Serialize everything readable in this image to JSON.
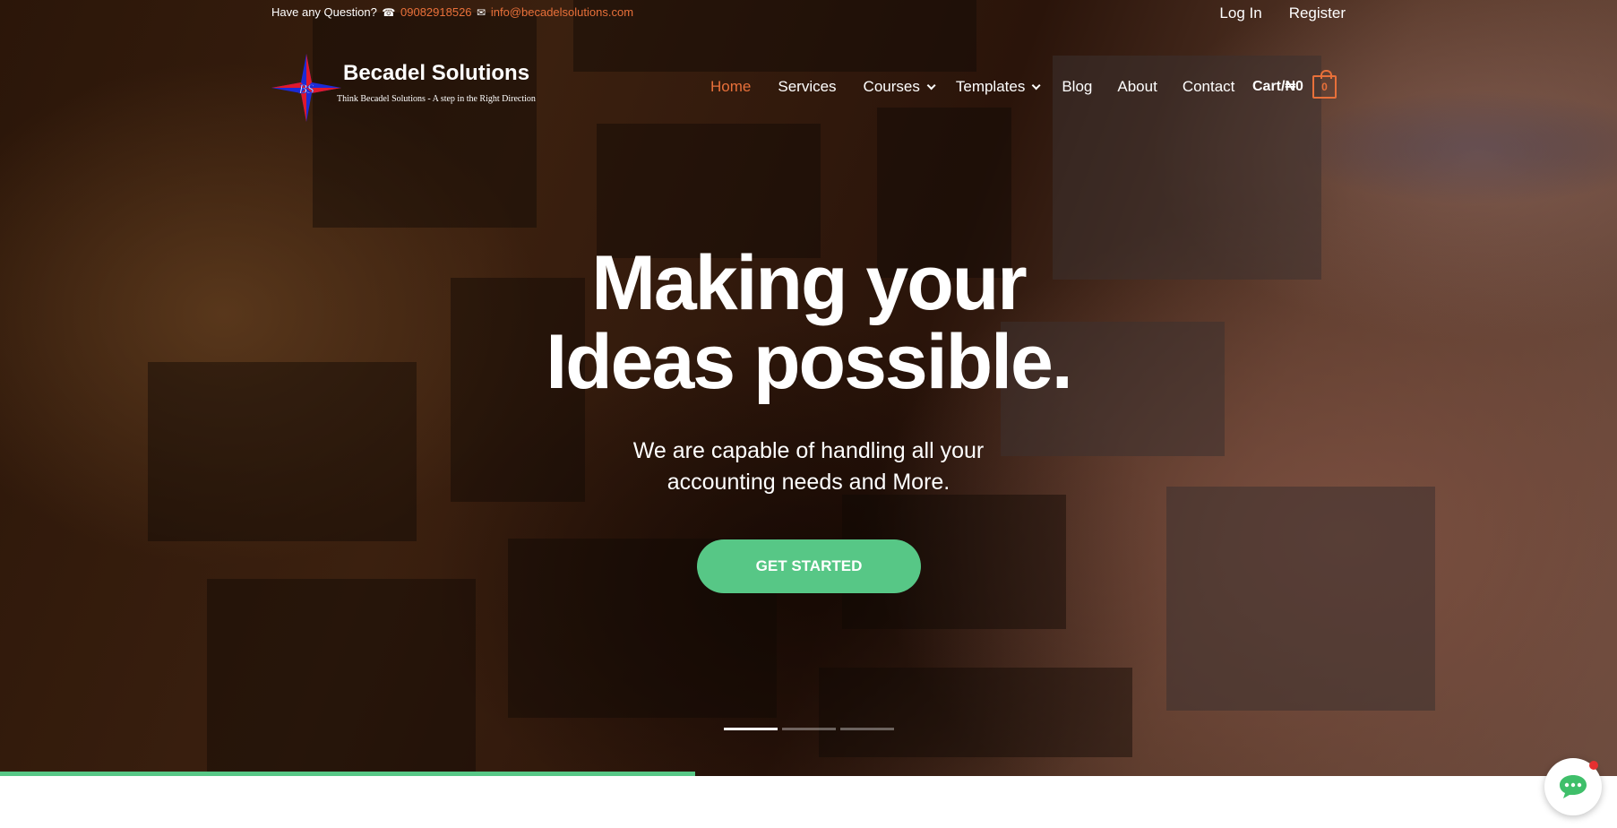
{
  "topbar": {
    "question_label": "Have any Question?",
    "phone_icon": "☎",
    "phone": "09082918526",
    "email_icon": "✉",
    "email": "info@becadelsolutions.com"
  },
  "auth": {
    "login": "Log In",
    "register": "Register"
  },
  "logo": {
    "brand": "Becadel Solutions",
    "tagline": "Think Becadel Solutions - A step in the Right Direction",
    "monogram": "BS"
  },
  "nav": {
    "items": [
      {
        "label": "Home",
        "active": true
      },
      {
        "label": "Services"
      },
      {
        "label": "Courses",
        "dropdown": true
      },
      {
        "label": "Templates",
        "dropdown": true
      },
      {
        "label": "Blog"
      },
      {
        "label": "About"
      },
      {
        "label": "Contact"
      }
    ]
  },
  "cart": {
    "label": "Cart/",
    "amount": "₦0",
    "count": "0"
  },
  "hero": {
    "headline_line1": "Making your",
    "headline_line2": "Ideas possible.",
    "sub_line1": "We are capable of handling all your",
    "sub_line2": "accounting needs and More.",
    "cta": "GET STARTED"
  },
  "slider": {
    "slides": 3,
    "active_index": 0,
    "progress": 0.43
  },
  "colors": {
    "accent": "#e8703a",
    "cta": "#57c786",
    "progress": "#57c786"
  },
  "icons": [
    "phone-icon",
    "mail-icon",
    "chevron-down-icon",
    "cart-bag-icon",
    "chat-icon"
  ]
}
